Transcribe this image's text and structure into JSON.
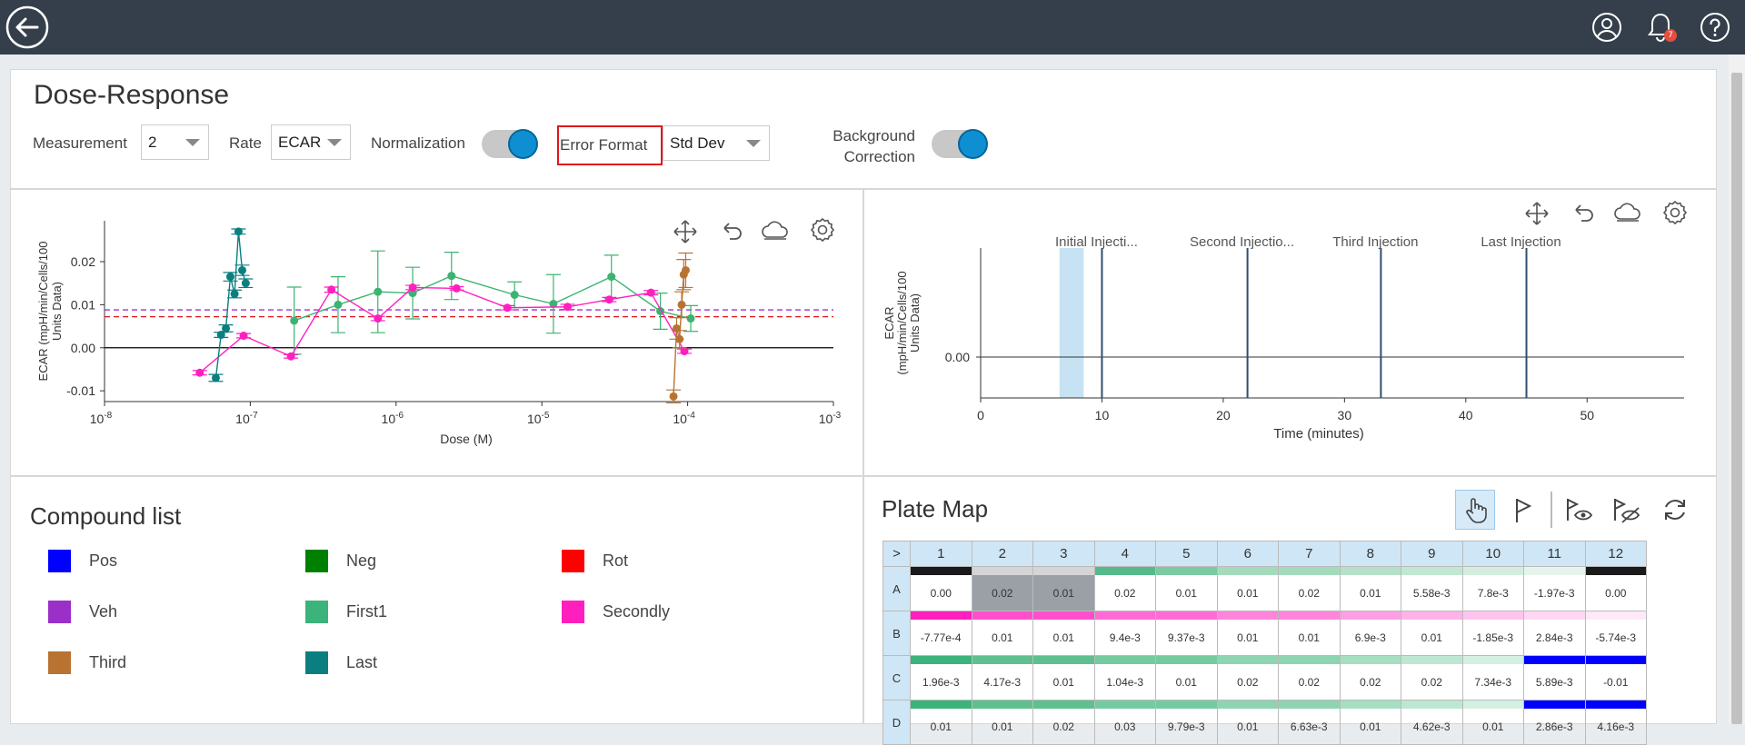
{
  "header": {
    "notification_count": "7"
  },
  "page": {
    "title": "Dose-Response"
  },
  "controls": {
    "measurement_label": "Measurement",
    "measurement_value": "2",
    "rate_label": "Rate",
    "rate_value": "ECAR",
    "normalization_label": "Normalization",
    "error_format_label": "Error Format",
    "error_format_value": "Std Dev",
    "background_label_line1": "Background",
    "background_label_line2": "Correction",
    "normalization_on": true,
    "background_on": true
  },
  "chart_data": [
    {
      "type": "scatter",
      "title": "",
      "xlabel": "Dose (M)",
      "ylabel": "ECAR (mpH/min/Cells/100 Units Data)",
      "x_scale": "log",
      "xlim": [
        1e-08,
        0.001
      ],
      "ylim": [
        -0.0125,
        0.0295
      ],
      "x_ticks": [
        "10-8",
        "10-7",
        "10-6",
        "10-5",
        "10-4",
        "10-3"
      ],
      "y_ticks": [
        "0.02",
        "0.01",
        "0.00",
        "-0.01"
      ],
      "reference_lines": [
        {
          "y": 0.0,
          "color": "#000000"
        },
        {
          "y": 0.0088,
          "color": "#9b30d9",
          "style": "dashed"
        },
        {
          "y": 0.0072,
          "color": "#e0161e",
          "style": "dashed"
        }
      ],
      "series": [
        {
          "name": "First1",
          "color": "#3cb371",
          "x": [
            2e-07,
            4e-07,
            7.5e-07,
            1.3e-06,
            2.4e-06,
            6.5e-06,
            1.2e-05,
            3e-05,
            6.5e-05,
            0.000105
          ],
          "y": [
            0.0063,
            0.01,
            0.013,
            0.0127,
            0.0167,
            0.0123,
            0.0102,
            0.0165,
            0.0085,
            0.0068
          ],
          "err": [
            0.0078,
            0.0065,
            0.0095,
            0.006,
            0.0055,
            0.003,
            0.0068,
            0.005,
            0.0042,
            0.003
          ]
        },
        {
          "name": "Secondly",
          "color": "#ff1fbf",
          "x": [
            4.5e-08,
            9e-08,
            1.9e-07,
            3.6e-07,
            7.5e-07,
            1.3e-06,
            2.6e-06,
            5.8e-06,
            1.5e-05,
            2.9e-05,
            5.6e-05,
            9.5e-05
          ],
          "y": [
            -0.0058,
            0.0028,
            -0.002,
            0.0135,
            0.0068,
            0.014,
            0.0138,
            0.0093,
            0.0095,
            0.0112,
            0.0128,
            -0.0008
          ],
          "err": [
            0.0005,
            0.0005,
            0.0004,
            0.0006,
            0.0005,
            0.0005,
            0.0004,
            0.0005,
            0.0006,
            0.0005,
            0.0005,
            0.0005
          ]
        },
        {
          "name": "Last",
          "color": "#0b7f7f",
          "x": [
            5.8e-08,
            6.3e-08,
            6.8e-08,
            7.3e-08,
            7.8e-08,
            8.3e-08,
            8.8e-08,
            9.3e-08
          ],
          "y": [
            -0.007,
            0.003,
            0.0045,
            0.0165,
            0.0125,
            0.027,
            0.018,
            0.015
          ],
          "err": [
            0.0008,
            0.0006,
            0.0008,
            0.001,
            0.0009,
            0.0006,
            0.0012,
            0.001
          ]
        },
        {
          "name": "Third",
          "color": "#b87333",
          "x": [
            8e-05,
            8.4e-05,
            8.8e-05,
            9.1e-05,
            9.4e-05,
            9.7e-05
          ],
          "y": [
            -0.0113,
            0.0045,
            0.002,
            0.01,
            0.017,
            0.018
          ],
          "err": [
            0.0015,
            0.0025,
            0.002,
            0.003,
            0.0035,
            0.004
          ]
        }
      ]
    },
    {
      "type": "line",
      "title": "",
      "xlabel": "Time (minutes)",
      "ylabel": "ECAR (mpH/min/Cells/100 Units Data)",
      "xlim": [
        0,
        58
      ],
      "x_ticks": [
        "0",
        "10",
        "20",
        "30",
        "40",
        "50"
      ],
      "y_ticks": [
        "0.00"
      ],
      "shaded_range": [
        6.5,
        8.5
      ],
      "injections": [
        {
          "label": "Initial Injecti...",
          "x": 10
        },
        {
          "label": "Second Injectio...",
          "x": 22
        },
        {
          "label": "Third Injection",
          "x": 33
        },
        {
          "label": "Last Injection",
          "x": 45
        }
      ]
    }
  ],
  "compound_list": {
    "title": "Compound list",
    "items": [
      {
        "label": "Pos",
        "color": "#0000ff"
      },
      {
        "label": "Neg",
        "color": "#008000"
      },
      {
        "label": "Rot",
        "color": "#ff0000"
      },
      {
        "label": "Veh",
        "color": "#9b30c9"
      },
      {
        "label": "First1",
        "color": "#3cb37b"
      },
      {
        "label": "Secondly",
        "color": "#ff1fbf"
      },
      {
        "label": "Third",
        "color": "#b87333"
      },
      {
        "label": "Last",
        "color": "#0b7f7f"
      }
    ]
  },
  "plate_map": {
    "title": "Plate Map",
    "corner": ">",
    "columns": [
      "1",
      "2",
      "3",
      "4",
      "5",
      "6",
      "7",
      "8",
      "9",
      "10",
      "11",
      "12"
    ],
    "rows": [
      {
        "label": "A",
        "values": [
          "0.00",
          "0.02",
          "0.01",
          "0.02",
          "0.01",
          "0.01",
          "0.02",
          "0.01",
          "5.58e-3",
          "7.8e-3",
          "-1.97e-3",
          "0.00"
        ],
        "bars": [
          "#1a1a1a",
          "#d5d5d5",
          "#d5d5d5",
          "#55b98a",
          "#7cc9a2",
          "#a5dbbd",
          "#a5dbbd",
          "#b5e1c8",
          "#c2e7d2",
          "#d3eedf",
          "#e6f5ec",
          "#1a1a1a"
        ]
      },
      {
        "label": "B",
        "values": [
          "-7.77e-4",
          "0.01",
          "0.01",
          "9.4e-3",
          "9.37e-3",
          "0.01",
          "0.01",
          "6.9e-3",
          "0.01",
          "-1.85e-3",
          "2.84e-3",
          "-5.74e-3"
        ],
        "bars": [
          "#ff1fbf",
          "#ff4fcd",
          "#ff4fcd",
          "#ff6bd5",
          "#ff6bd5",
          "#ff85dc",
          "#ff85dc",
          "#ff9ee3",
          "#ffb1e8",
          "#ffc4ee",
          "#ffd7f3",
          "#ffe8f8"
        ]
      },
      {
        "label": "C",
        "values": [
          "1.96e-3",
          "4.17e-3",
          "0.01",
          "1.04e-3",
          "0.01",
          "0.02",
          "0.02",
          "0.02",
          "0.02",
          "7.34e-3",
          "5.89e-3",
          "-0.01"
        ],
        "bars": [
          "#3cb37b",
          "#5ec08f",
          "#5ec08f",
          "#76caa0",
          "#76caa0",
          "#8ed4b1",
          "#8ed4b1",
          "#a6dec2",
          "#bde7d2",
          "#d4f0e2",
          "#0000ff",
          "#0000ff"
        ]
      },
      {
        "label": "D",
        "values": [
          "0.01",
          "0.01",
          "0.02",
          "0.03",
          "9.79e-3",
          "0.01",
          "6.63e-3",
          "0.01",
          "4.62e-3",
          "0.01",
          "2.86e-3",
          "4.16e-3"
        ],
        "bars": [
          "#3cb37b",
          "#5ec08f",
          "#5ec08f",
          "#76caa0",
          "#76caa0",
          "#8ed4b1",
          "#8ed4b1",
          "#a6dec2",
          "#bde7d2",
          "#d4f0e2",
          "#0000ff",
          "#0000ff"
        ]
      }
    ]
  }
}
